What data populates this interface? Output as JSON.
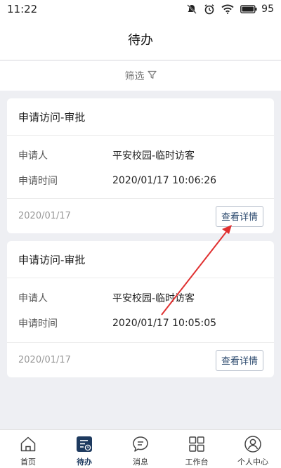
{
  "status_bar": {
    "time": "11:22",
    "battery": "95"
  },
  "nav": {
    "title": "待办"
  },
  "filter": {
    "label": "筛选"
  },
  "cards": [
    {
      "title": "申请访问-审批",
      "fields": [
        {
          "label": "申请人",
          "value": "平安校园-临时访客"
        },
        {
          "label": "申请时间",
          "value": "2020/01/17 10:06:26"
        }
      ],
      "date": "2020/01/17",
      "button": "查看详情"
    },
    {
      "title": "申请访问-审批",
      "fields": [
        {
          "label": "申请人",
          "value": "平安校园-临时访客"
        },
        {
          "label": "申请时间",
          "value": "2020/01/17 10:05:05"
        }
      ],
      "date": "2020/01/17",
      "button": "查看详情"
    }
  ],
  "tabs": [
    {
      "label": "首页",
      "icon": "home-icon"
    },
    {
      "label": "待办",
      "icon": "todo-icon"
    },
    {
      "label": "消息",
      "icon": "message-icon"
    },
    {
      "label": "工作台",
      "icon": "grid-icon"
    },
    {
      "label": "个人中心",
      "icon": "person-icon"
    }
  ],
  "colors": {
    "accent": "#1e3a5f",
    "annotation_arrow": "#e03030"
  }
}
